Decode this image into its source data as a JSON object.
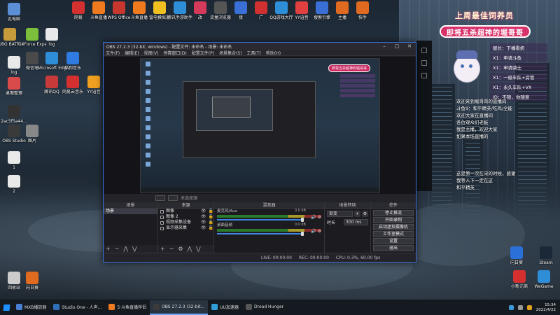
{
  "desktop": {
    "icons_left": [
      {
        "label": "此电脑",
        "color": "#5b8fd6"
      },
      {
        "label": "PUBG BATTLEGR...",
        "color": "#c79b3a"
      },
      {
        "label": "GeForce Experience",
        "color": "#7bbf3a"
      },
      {
        "label": "log",
        "color": "#e9e9e9"
      },
      {
        "label": "log",
        "color": "#e9e9e9"
      },
      {
        "label": "微信电",
        "color": "#4a4a4a"
      },
      {
        "label": "Microsoft Edge",
        "color": "#2f8ed8"
      },
      {
        "label": "酷狗音乐",
        "color": "#2f7be0"
      },
      {
        "label": "桌面整理",
        "color": "#d94b4b"
      },
      {
        "label": "腾讯QQ",
        "color": "#c73a3a"
      },
      {
        "label": "网易云音乐",
        "color": "#d43030"
      },
      {
        "label": "YY语音",
        "color": "#f0a020"
      },
      {
        "label": "2ac5f5a44...",
        "color": "#333333"
      },
      {
        "label": "OBS Studio",
        "color": "#3a3a3a"
      },
      {
        "label": "图片",
        "color": "#888888"
      },
      {
        "label": "1",
        "color": "#e9e9e9"
      },
      {
        "label": "2",
        "color": "#e9e9e9"
      },
      {
        "label": "回收站",
        "color": "#cccccc"
      },
      {
        "label": "向日葵",
        "color": "#e06a1f"
      }
    ],
    "icons_top": [
      {
        "label": "网易",
        "color": "#d43030"
      },
      {
        "label": "斗鱼直播",
        "color": "#f07b1f"
      },
      {
        "label": "WPS Office",
        "color": "#c8372d"
      },
      {
        "label": "斗鱼直播",
        "color": "#f07b1f"
      },
      {
        "label": "雷电模拟器",
        "color": "#f0c020"
      },
      {
        "label": "腾讯手游助手",
        "color": "#2f8ed8"
      },
      {
        "label": "改",
        "color": "#d63a5a"
      },
      {
        "label": "流量浏览器",
        "color": "#555555"
      },
      {
        "label": "接",
        "color": "#3a6fd6"
      },
      {
        "label": "广",
        "color": "#d03030"
      },
      {
        "label": "QQ游戏大厅",
        "color": "#2f8ed8"
      },
      {
        "label": "YY语音",
        "color": "#e04040"
      },
      {
        "label": "搜索引擎",
        "color": "#3a6fd6"
      },
      {
        "label": "主播",
        "color": "#e06a1f"
      },
      {
        "label": "快手",
        "color": "#e06a1f"
      }
    ],
    "icons_right": [
      {
        "label": "向日葵",
        "color": "#2b6fd8"
      },
      {
        "label": "Steam",
        "color": "#1b2838"
      },
      {
        "label": "小新元商",
        "color": "#d43030"
      },
      {
        "label": "WeGame",
        "color": "#2f8ed8"
      }
    ]
  },
  "overlay": {
    "title": "上周最佳饲养员",
    "banner": "即将五杀超神的堀哥哥",
    "board": [
      "舰长：下播看奶",
      "X1：申请斗鱼",
      "X1：申请骑士",
      "X1：一级车队+房管",
      "X1：永久车队+VX",
      "ID：不限，你随意"
    ],
    "chat1": [
      "欢迎来到堀哥哥的直播间",
      "斗鱼9：和平精英/吃鸡/全能",
      "欢迎大家在直播间",
      "各位观众们老板",
      "我是主播，欢迎大家",
      "如果本场直播的"
    ],
    "chat2": [
      "这是第一次在宋的时候，感谢",
      "我等人下一定在这",
      "和平精英"
    ]
  },
  "obs": {
    "title": "OBS 27.2.3 (32-bit, windows) - 配置文件: 未命名 - 场景: 未命名",
    "menu": [
      "文件(F)",
      "编辑(E)",
      "视图(V)",
      "停靠窗口(D)",
      "配置文件(P)",
      "场景集合(S)",
      "工具(T)",
      "帮助(H)"
    ],
    "controls_bar_label": "未选择源",
    "scenes_header": "场景",
    "scenes": [
      "场景"
    ],
    "sources_header": "来源",
    "sources": [
      {
        "name": "图像"
      },
      {
        "name": "图像 2"
      },
      {
        "name": "视频采集设备"
      },
      {
        "name": "显示器采集"
      }
    ],
    "mixer_header": "混音器",
    "mixer": [
      {
        "name": "麦克风/Aux",
        "db": "0.0 dB"
      },
      {
        "name": "桌面音频",
        "db": "0.0 dB"
      }
    ],
    "transitions_header": "场景转场",
    "transition_type": "渐变",
    "duration_label": "时长",
    "duration_value": "300 ms",
    "controls_header": "控件",
    "controls": [
      "停止推流",
      "开始录制",
      "启动虚拟摄像机",
      "工作室模式",
      "设置",
      "退出"
    ],
    "status": {
      "live": "LIVE: 00:00:00",
      "rec": "REC: 00:00:00",
      "cpu": "CPU: 0.3%, 60.00 fps"
    },
    "preview_banner": "即将五杀超神的堀哥哥"
  },
  "taskbar": {
    "items": [
      {
        "label": "MXB播放器",
        "color": "#4a7fd6",
        "active": false
      },
      {
        "label": "Studio One - 人声...",
        "color": "#2f6fb8",
        "active": false
      },
      {
        "label": "5·斗鱼直播伴侣",
        "color": "#f07b1f",
        "active": false
      },
      {
        "label": "OBS 27.2.3 (32-bit...",
        "color": "#3a3a3a",
        "active": true
      },
      {
        "label": "UU加速器",
        "color": "#2f9ed8",
        "active": false
      },
      {
        "label": "Dread Hunger",
        "color": "#555555",
        "active": false
      }
    ],
    "time": "15:34",
    "date": "2022/4/22"
  }
}
